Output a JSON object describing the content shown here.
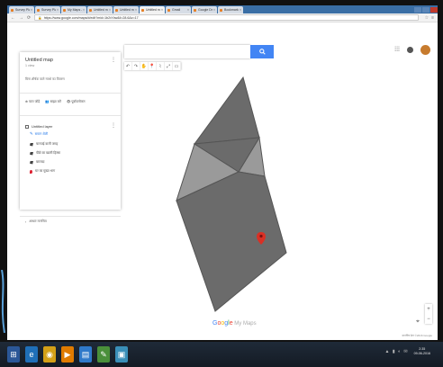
{
  "browser": {
    "tabs": [
      {
        "label": "Survey Plan - ...",
        "active": false
      },
      {
        "label": "Survey Plan - ...",
        "active": false
      },
      {
        "label": "My Maps - ...",
        "active": false
      },
      {
        "label": "Untitled map",
        "active": false
      },
      {
        "label": "Untitled map",
        "active": false
      },
      {
        "label": "Untitled map",
        "active": true
      },
      {
        "label": "Gmail",
        "active": false
      },
      {
        "label": "Google Drive",
        "active": false
      },
      {
        "label": "Bookmarks",
        "active": false
      }
    ],
    "tab_close": "×",
    "url_lock": "🔒",
    "url": "https://www.google.com/maps/d/edit?mid=1b2rXhw&ll=28.6&z=17"
  },
  "map": {
    "search_placeholder": "",
    "search_button_icon": "search-icon",
    "toolbar": [
      "↶",
      "↷",
      "✋",
      "📍",
      "⌇",
      "⤢",
      "▭"
    ],
    "fill_colors": {
      "main": "#6b6b6b",
      "light": "#9a9a9a",
      "stroke": "#555555"
    },
    "marker_color": "#d93025"
  },
  "panel": {
    "title": "Untitled map",
    "subtitle": "1 view",
    "description": "बिना शीर्षक वाले नक्शे का विवरण",
    "more": "⋮",
    "actions": [
      "⊕ परत जोड़ें",
      "👥 साझा करें",
      "👁 पूर्वावलोकन"
    ],
    "layer": {
      "name": "Untitled layer",
      "style": "समान शैली",
      "features": [
        "चारपाई वाली जगह",
        "पीछे का खाली हिस्सा",
        "बरामदा",
        "घर का मुख्य भाग"
      ]
    },
    "base_map": "आधार मानचित्र"
  },
  "branding": {
    "g": "G",
    "o1": "o",
    "o2": "o",
    "g2": "g",
    "l": "l",
    "e": "e",
    "mymaps": " My Maps"
  },
  "controls": {
    "zoom_in": "+",
    "zoom_out": "−",
    "my_location": "⌖",
    "footer": "मानचित्र डेटा ©2016 Google"
  },
  "taskbar": {
    "start": "⊞",
    "apps": [
      {
        "name": "ie",
        "color": "#1f6fb8",
        "glyph": "e"
      },
      {
        "name": "chrome",
        "color": "#d4a017",
        "glyph": "◉"
      },
      {
        "name": "media",
        "color": "#e07b00",
        "glyph": "▶"
      },
      {
        "name": "explorer",
        "color": "#2f79c9",
        "glyph": "▤"
      },
      {
        "name": "paint",
        "color": "#4a8f3a",
        "glyph": "✎"
      },
      {
        "name": "app",
        "color": "#3a8fb8",
        "glyph": "▣"
      }
    ],
    "tray_icons": "▲ ▮ ◐ ✉",
    "time": "2:35",
    "date": "09-06-2016"
  }
}
